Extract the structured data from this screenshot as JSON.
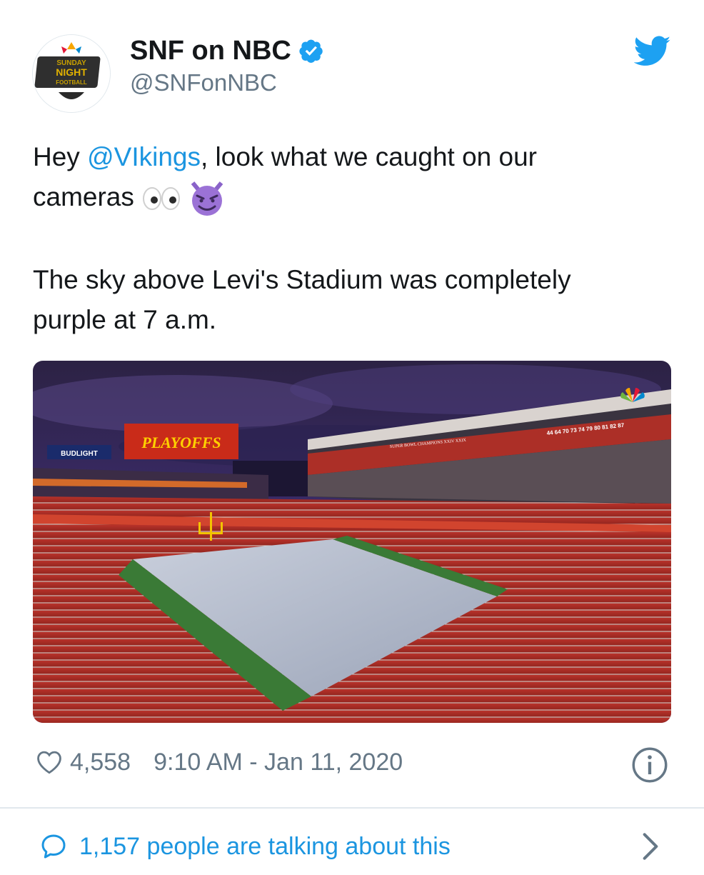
{
  "account": {
    "display_name": "SNF on NBC",
    "handle": "@SNFonNBC",
    "avatar_text": [
      "SUNDAY",
      "NIGHT",
      "FOOTBALL"
    ]
  },
  "tweet": {
    "line1_prefix": "Hey ",
    "mention": "@VIkings",
    "line1_suffix": ", look what we caught on our",
    "line1b": "cameras",
    "line2a": "The sky above Levi's Stadium was completely",
    "line2b": "purple at 7 a.m.",
    "emoji": [
      "eyes-emoji",
      "smiling-imp-emoji"
    ]
  },
  "photo": {
    "scoreboard_text": "PLAYOFFS",
    "sponsor_text": "BUDLIGHT",
    "ring_text_1": "44 64 70 73 74 79 80 81 82 87",
    "ring_text_2": "SUPER BOWL CHAMPIONS XXIV XXIX"
  },
  "footer": {
    "likes": "4,558",
    "timestamp": "9:10 AM - Jan 11, 2020",
    "talking": "1,157 people are talking about this"
  },
  "colors": {
    "link": "#1b95e0",
    "muted": "#657786",
    "verified": "#1da1f2",
    "divider": "#e1e8ed"
  },
  "icons": [
    "verified-badge-icon",
    "twitter-bird-icon",
    "heart-icon",
    "info-icon",
    "speech-bubble-icon",
    "chevron-right-icon"
  ]
}
